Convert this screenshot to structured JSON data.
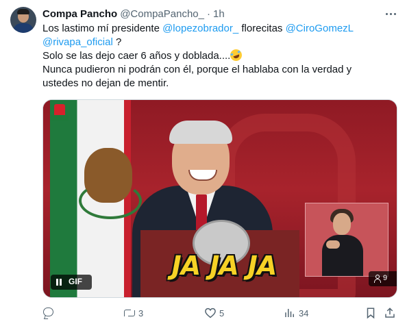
{
  "tweet": {
    "author_name": "Compa Pancho",
    "handle": "@CompaPancho_",
    "dot": "·",
    "time": "1h",
    "body": {
      "line1_a": "Los lastimo mí presidente ",
      "mention1": "@lopezobrador_",
      "line1_b": " florecitas ",
      "mention2": "@CiroGomezL",
      "mention3": "@rivapa_oficial",
      "line2_b": " ?",
      "line3": "Solo se las dejo caer 6 años y doblada....",
      "line4": "Nunca pudieron ni podrán con él, porque el hablaba con la verdad y",
      "line5": "ustedes no dejan de mentir."
    }
  },
  "media": {
    "overlay_text": [
      "JA",
      "JA",
      "JA"
    ],
    "gif_label": "GIF",
    "view_count": "9"
  },
  "actions": {
    "replies": "",
    "retweets": "3",
    "likes": "5",
    "views": "34"
  },
  "icons": [
    "more-icon",
    "emoji-rofl-icon",
    "pause-icon",
    "viewer-icon",
    "reply-icon",
    "retweet-icon",
    "like-icon",
    "views-icon",
    "bookmark-icon",
    "share-icon"
  ],
  "colors": {
    "link": "#1d9bf0",
    "muted": "#536471",
    "text": "#0f1419"
  }
}
